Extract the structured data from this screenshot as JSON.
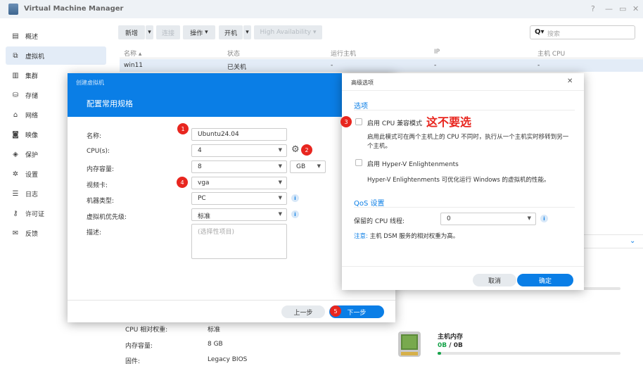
{
  "app": {
    "title": "Virtual Machine Manager",
    "help": "?",
    "minimize": "—",
    "maximize": "▭",
    "close": "✕"
  },
  "sidebar": {
    "items": [
      {
        "label": "概述",
        "icon": "overview-icon"
      },
      {
        "label": "虚拟机",
        "icon": "vm-icon"
      },
      {
        "label": "集群",
        "icon": "cluster-icon"
      },
      {
        "label": "存储",
        "icon": "storage-icon"
      },
      {
        "label": "网络",
        "icon": "network-icon"
      },
      {
        "label": "映像",
        "icon": "image-icon"
      },
      {
        "label": "保护",
        "icon": "shield-icon"
      },
      {
        "label": "设置",
        "icon": "gear-icon"
      },
      {
        "label": "日志",
        "icon": "log-icon"
      },
      {
        "label": "许可证",
        "icon": "key-icon"
      },
      {
        "label": "反馈",
        "icon": "mail-icon"
      }
    ]
  },
  "toolbar": {
    "new": "新增",
    "connect": "连接",
    "action": "操作",
    "power": "开机",
    "ha": "High Availability",
    "search_placeholder": "搜索"
  },
  "table": {
    "headers": [
      "名称 ▴",
      "状态",
      "运行主机",
      "IP",
      "主机 CPU"
    ],
    "row": [
      "win11",
      "已关机",
      "-",
      "-",
      "-"
    ]
  },
  "wizard": {
    "breadcrumb": "创建虚拟机",
    "title": "配置常用规格",
    "fields": {
      "name_label": "名称:",
      "name_value": "Ubuntu24.04",
      "cpu_label": "CPU(s):",
      "cpu_value": "4",
      "mem_label": "内存容量:",
      "mem_value": "8",
      "mem_unit": "GB",
      "vga_label": "视频卡:",
      "vga_value": "vga",
      "machine_label": "机器类型:",
      "machine_value": "PC",
      "priority_label": "虚拟机优先级:",
      "priority_value": "标准",
      "desc_label": "描述:",
      "desc_placeholder": "(选择性项目)"
    },
    "prev": "上一步",
    "next": "下一步"
  },
  "advanced": {
    "title": "高级选项",
    "section_options": "选项",
    "cpu_compat_label": "启用 CPU 兼容模式",
    "cpu_compat_desc": "启用此模式可在两个主机上的 CPU 不同时，执行从一个主机实时移转到另一个主机。",
    "hyperv_label": "启用 Hyper-V Enlightenments",
    "hyperv_desc": "Hyper-V Enlightenments 可优化运行 Windows 的虚拟机的性能。",
    "section_qos": "QoS 设置",
    "reserved_label": "保留的 CPU 线程:",
    "reserved_value": "0",
    "note_prefix": "注意:",
    "note_text": "主机 DSM 服务的相对权重为高。",
    "cancel": "取消",
    "ok": "确定"
  },
  "annotation": {
    "warning": "这不要选",
    "b1": "1",
    "b2": "2",
    "b3": "3",
    "b4": "4",
    "b5": "5"
  },
  "details": {
    "cpu_weight_label": "CPU 相对权重:",
    "cpu_weight_value": "标准",
    "mem_label": "内存容量:",
    "mem_value": "8 GB",
    "firmware_label": "固件:",
    "firmware_value": "Legacy BIOS"
  },
  "host_memory": {
    "title": "主机内存",
    "used": "0B",
    "sep": " / ",
    "total": "0B",
    "usage_fraction": 0.02
  },
  "colors": {
    "accent": "#0a7ee6",
    "badge": "#e8261f",
    "selected_row": "#e3ecf7"
  }
}
